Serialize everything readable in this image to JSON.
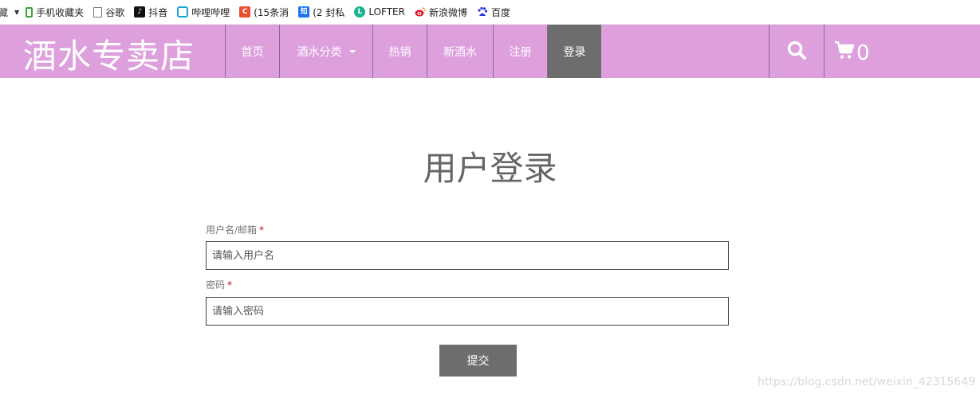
{
  "bookmarks": {
    "first": "藏",
    "items": [
      {
        "label": "手机收藏夹",
        "icon": "phone-icon"
      },
      {
        "label": "谷歌",
        "icon": "document-icon"
      },
      {
        "label": "抖音",
        "icon": "tiktok-icon"
      },
      {
        "label": "哔哩哔哩",
        "icon": "bilibili-icon"
      },
      {
        "label": "(15条消",
        "icon": "csdn-icon"
      },
      {
        "label": "(2 封私",
        "icon": "zhihu-icon"
      },
      {
        "label": "LOFTER",
        "icon": "lofter-icon"
      },
      {
        "label": "新浪微博",
        "icon": "weibo-icon"
      },
      {
        "label": "百度",
        "icon": "baidu-icon"
      }
    ]
  },
  "header": {
    "logo": "酒水专卖店",
    "nav": [
      {
        "label": "首页"
      },
      {
        "label": "酒水分类"
      },
      {
        "label": "热销"
      },
      {
        "label": "新酒水"
      },
      {
        "label": "注册"
      },
      {
        "label": "登录"
      }
    ],
    "cart_count": "0",
    "colors": {
      "bar": "#dda0dd",
      "active": "#6d6d6d"
    }
  },
  "main": {
    "title": "用户登录",
    "username_label": "用户名/邮箱",
    "username_placeholder": "请输入用户名",
    "password_label": "密码",
    "password_placeholder": "请输入密码",
    "required_mark": "*",
    "submit_label": "提交"
  },
  "watermark": "https://blog.csdn.net/weixin_42315649"
}
